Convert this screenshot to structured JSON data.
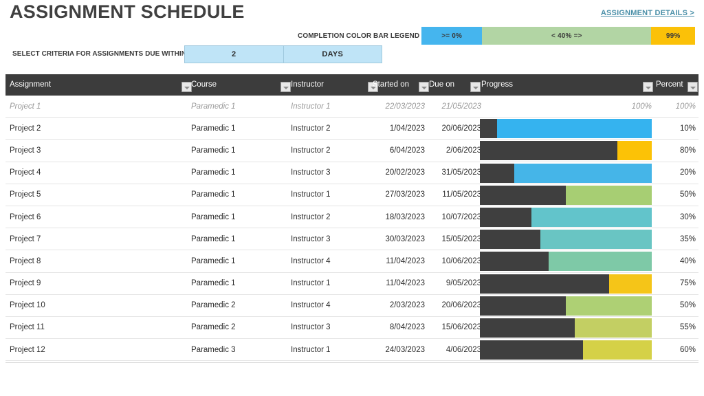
{
  "header": {
    "title": "ASSIGNMENT SCHEDULE",
    "details_link": "ASSIGNMENT DETAILS >"
  },
  "legend": {
    "label": "COMPLETION COLOR BAR LEGEND",
    "segments": [
      {
        "label": ">= 0%",
        "color": "#45b5ee"
      },
      {
        "label": "< 40% =>",
        "color": "#b2d5a4"
      },
      {
        "label": "99%",
        "color": "#fbc108"
      }
    ]
  },
  "criteria": {
    "label": "SELECT CRITERIA FOR ASSIGNMENTS DUE WITHIN:",
    "value": "2",
    "unit": "DAYS"
  },
  "table": {
    "columns": [
      {
        "key": "assignment",
        "label": "Assignment"
      },
      {
        "key": "course",
        "label": "Course"
      },
      {
        "key": "instructor",
        "label": "Instructor"
      },
      {
        "key": "started_on",
        "label": "Started on"
      },
      {
        "key": "due_on",
        "label": "Due on"
      },
      {
        "key": "progress",
        "label": "Progress"
      },
      {
        "key": "percent",
        "label": "Percent"
      }
    ],
    "rows": [
      {
        "assignment": "Project 1",
        "course": "Paramedic 1",
        "instructor": "Instructor 1",
        "started_on": "22/03/2023",
        "due_on": "21/05/2023",
        "progress_label": "100%",
        "percent": "100%",
        "progress_value": 100,
        "ghost": true,
        "bar_color": "#ffffff"
      },
      {
        "assignment": "Project 2",
        "course": "Paramedic 1",
        "instructor": "Instructor 2",
        "started_on": "1/04/2023",
        "due_on": "20/06/2023",
        "progress_label": "",
        "percent": "10%",
        "progress_value": 10,
        "ghost": false,
        "bar_color": "#35b3ef"
      },
      {
        "assignment": "Project 3",
        "course": "Paramedic 1",
        "instructor": "Instructor 2",
        "started_on": "6/04/2023",
        "due_on": "2/06/2023",
        "progress_label": "",
        "percent": "80%",
        "progress_value": 80,
        "ghost": false,
        "bar_color": "#fcc206"
      },
      {
        "assignment": "Project 4",
        "course": "Paramedic 1",
        "instructor": "Instructor 3",
        "started_on": "20/02/2023",
        "due_on": "31/05/2023",
        "progress_label": "",
        "percent": "20%",
        "progress_value": 20,
        "ghost": false,
        "bar_color": "#45b5e8"
      },
      {
        "assignment": "Project 5",
        "course": "Paramedic 1",
        "instructor": "Instructor 1",
        "started_on": "27/03/2023",
        "due_on": "11/05/2023",
        "progress_label": "",
        "percent": "50%",
        "progress_value": 50,
        "ghost": false,
        "bar_color": "#a7ce73"
      },
      {
        "assignment": "Project 6",
        "course": "Paramedic 1",
        "instructor": "Instructor 2",
        "started_on": "18/03/2023",
        "due_on": "10/07/2023",
        "progress_label": "",
        "percent": "30%",
        "progress_value": 30,
        "ghost": false,
        "bar_color": "#62c4cb"
      },
      {
        "assignment": "Project 7",
        "course": "Paramedic 1",
        "instructor": "Instructor 3",
        "started_on": "30/03/2023",
        "due_on": "15/05/2023",
        "progress_label": "",
        "percent": "35%",
        "progress_value": 35,
        "ghost": false,
        "bar_color": "#69c5c3"
      },
      {
        "assignment": "Project 8",
        "course": "Paramedic 1",
        "instructor": "Instructor 4",
        "started_on": "11/04/2023",
        "due_on": "10/06/2023",
        "progress_label": "",
        "percent": "40%",
        "progress_value": 40,
        "ghost": false,
        "bar_color": "#7ec9a7"
      },
      {
        "assignment": "Project 9",
        "course": "Paramedic 1",
        "instructor": "Instructor 1",
        "started_on": "11/04/2023",
        "due_on": "9/05/2023",
        "progress_label": "",
        "percent": "75%",
        "progress_value": 75,
        "ghost": false,
        "bar_color": "#f5c518"
      },
      {
        "assignment": "Project 10",
        "course": "Paramedic 2",
        "instructor": "Instructor 4",
        "started_on": "2/03/2023",
        "due_on": "20/06/2023",
        "progress_label": "",
        "percent": "50%",
        "progress_value": 50,
        "ghost": false,
        "bar_color": "#aed074"
      },
      {
        "assignment": "Project 11",
        "course": "Paramedic 2",
        "instructor": "Instructor 3",
        "started_on": "8/04/2023",
        "due_on": "15/06/2023",
        "progress_label": "",
        "percent": "55%",
        "progress_value": 55,
        "ghost": false,
        "bar_color": "#c3cf63"
      },
      {
        "assignment": "Project 12",
        "course": "Paramedic 3",
        "instructor": "Instructor 1",
        "started_on": "24/03/2023",
        "due_on": "4/06/2023",
        "progress_label": "",
        "percent": "60%",
        "progress_value": 60,
        "ghost": false,
        "bar_color": "#d5d147"
      }
    ]
  },
  "colors": {
    "header_bg": "#3c3c3c",
    "bar_fill": "#3f3f3f",
    "accent_blue": "#bfe4f7",
    "link": "#4a8fa8"
  }
}
